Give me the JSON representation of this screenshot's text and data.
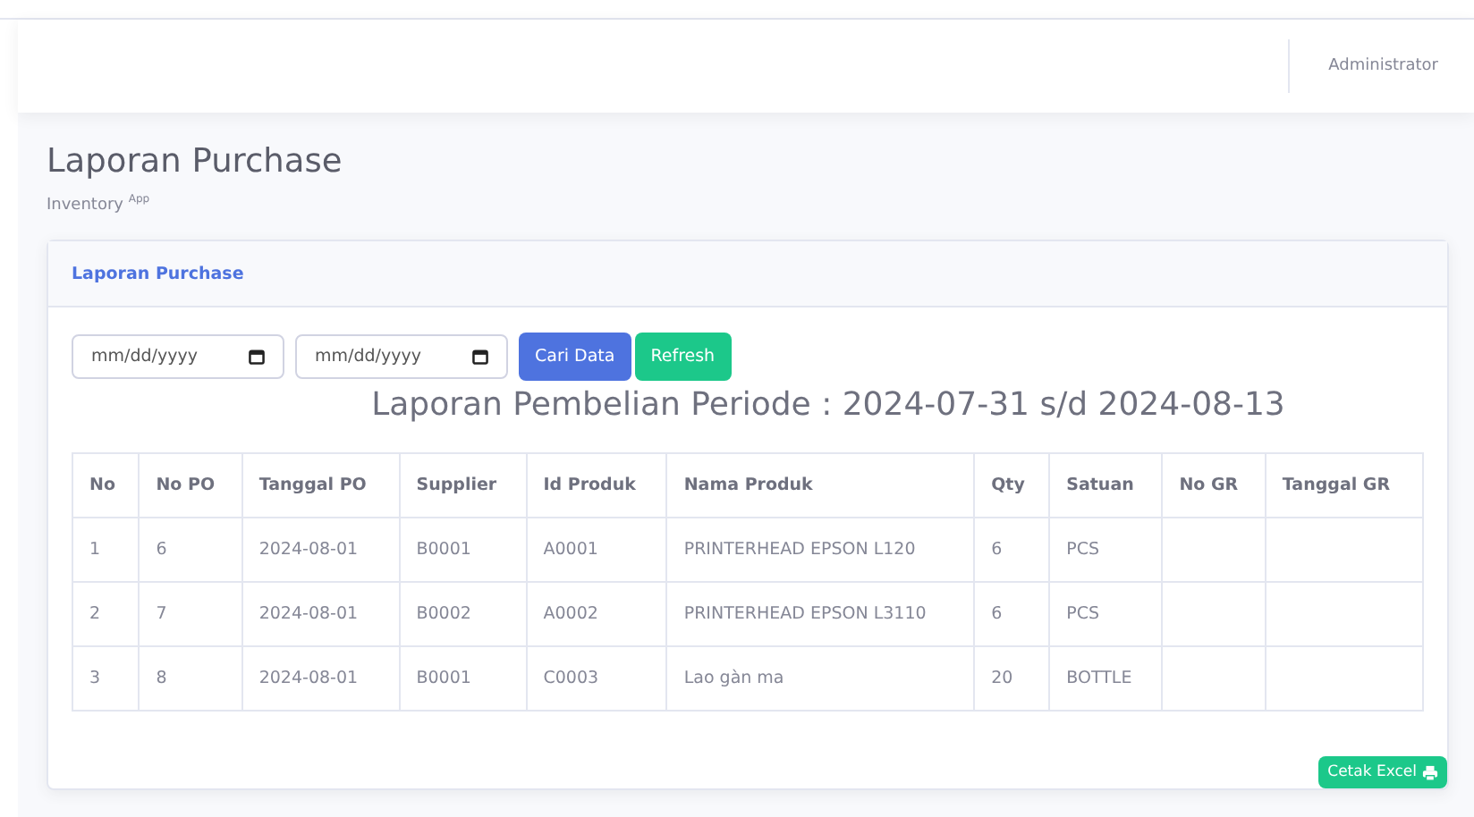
{
  "topbar": {
    "user": "Administrator"
  },
  "page": {
    "title": "Laporan Purchase",
    "subtitle": "Inventory $^{App}$"
  },
  "card": {
    "title": "Laporan Purchase",
    "filters": [
      {
        "placeholder": "mm/dd/yyyy"
      },
      {
        "placeholder": "mm/dd/yyyy"
      }
    ],
    "buttons": [
      {
        "label": "Cari Data",
        "kind": "primary"
      },
      {
        "label": "Refresh",
        "kind": "success"
      }
    ],
    "report_title": "Laporan Pembelian Periode : 2024-07-31 s/d 2024-08-13",
    "table": {
      "columns": [
        "No",
        "No PO",
        "Tanggal PO",
        "Supplier",
        "Id Produk",
        "Nama Produk",
        "Qty",
        "Satuan",
        "No GR",
        "Tanggal GR"
      ],
      "rows": [
        [
          "1",
          "6",
          "2024-08-01",
          "B0001",
          "A0001",
          "PRINTERHEAD EPSON L120",
          "6",
          "PCS",
          "",
          ""
        ],
        [
          "2",
          "7",
          "2024-08-01",
          "B0002",
          "A0002",
          "PRINTERHEAD EPSON L3110",
          "6",
          "PCS",
          "",
          ""
        ],
        [
          "3",
          "8",
          "2024-08-01",
          "B0001",
          "C0003",
          "Lao gàn ma",
          "20",
          "BOTTLE",
          "",
          ""
        ]
      ]
    },
    "export_button": "Cetak Excel"
  }
}
